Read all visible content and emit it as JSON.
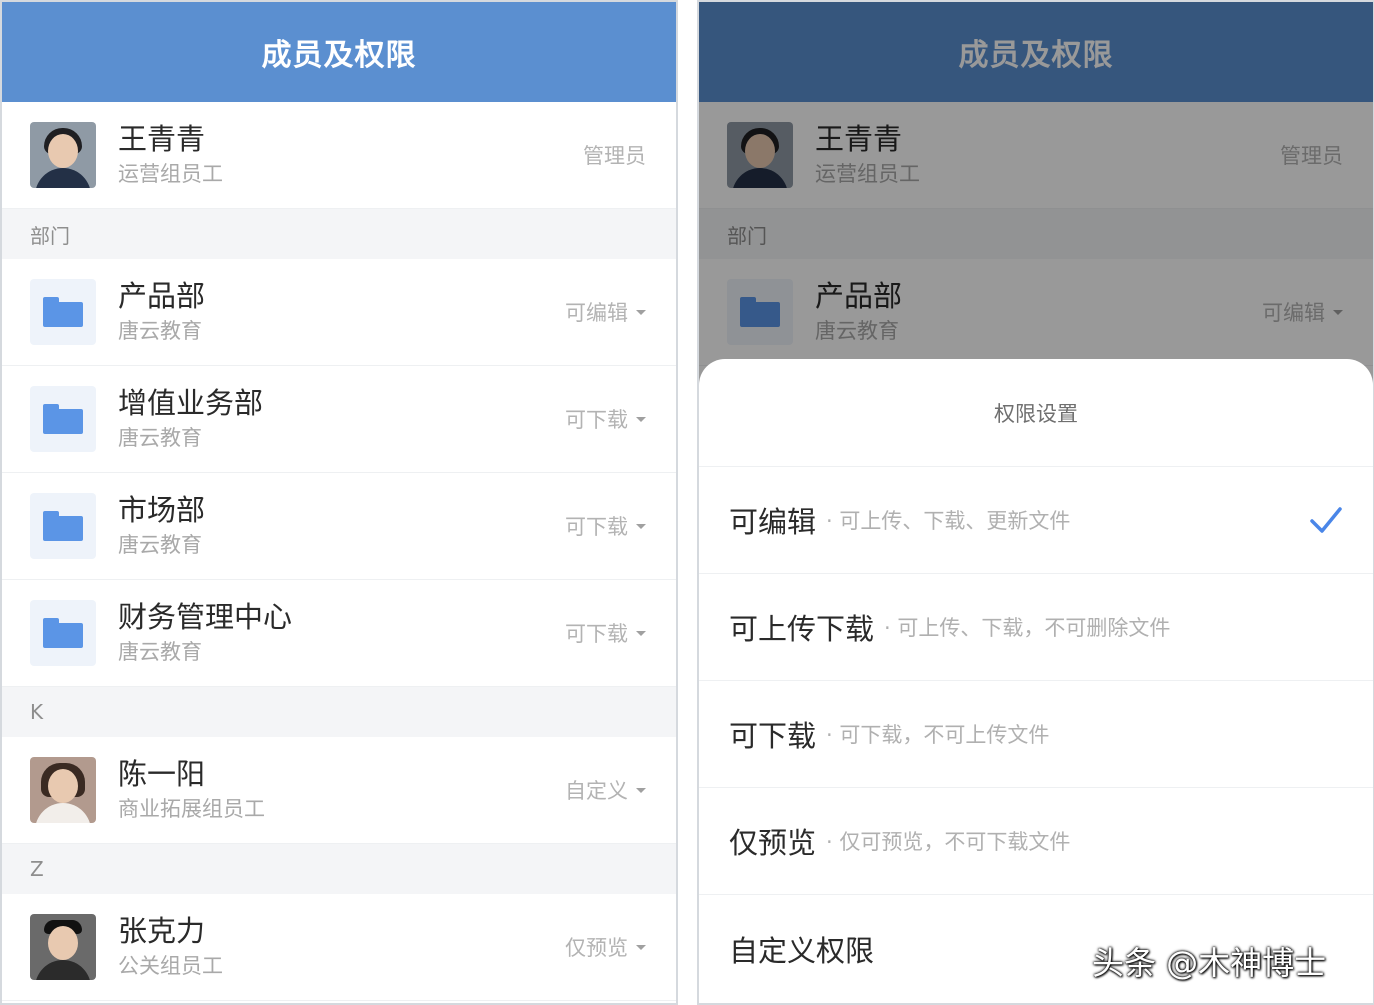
{
  "left": {
    "header": {
      "title": "成员及权限"
    },
    "admin": {
      "name": "王青青",
      "sub": "运营组员工",
      "role": "管理员"
    },
    "sections": {
      "dept": "部门",
      "k": "K",
      "z": "Z"
    },
    "departments": [
      {
        "name": "产品部",
        "sub": "唐云教育",
        "perm": "可编辑"
      },
      {
        "name": "增值业务部",
        "sub": "唐云教育",
        "perm": "可下载"
      },
      {
        "name": "市场部",
        "sub": "唐云教育",
        "perm": "可下载"
      },
      {
        "name": "财务管理中心",
        "sub": "唐云教育",
        "perm": "可下载"
      }
    ],
    "members": [
      {
        "name": "陈一阳",
        "sub": "商业拓展组员工",
        "perm": "自定义"
      },
      {
        "name": "张克力",
        "sub": "公关组员工",
        "perm": "仅预览"
      }
    ]
  },
  "right": {
    "header": {
      "title": "成员及权限"
    },
    "admin": {
      "name": "王青青",
      "sub": "运营组员工",
      "role": "管理员"
    },
    "sections": {
      "dept": "部门"
    },
    "department": {
      "name": "产品部",
      "sub": "唐云教育",
      "perm": "可编辑"
    },
    "sheet": {
      "title": "权限设置",
      "options": [
        {
          "label": "可编辑",
          "desc": "· 可上传、下载、更新文件",
          "selected": true
        },
        {
          "label": "可上传下载",
          "desc": "· 可上传、下载，不可删除文件",
          "selected": false
        },
        {
          "label": "可下载",
          "desc": "· 可下载，不可上传文件",
          "selected": false
        },
        {
          "label": "仅预览",
          "desc": "· 仅可预览，不可下载文件",
          "selected": false
        },
        {
          "label": "自定义权限",
          "desc": "",
          "selected": false
        }
      ]
    }
  },
  "watermark": "头条 @木神博士",
  "colors": {
    "header_left": "#5b8fd0",
    "accent": "#4a86e8",
    "folder": "#5b95e6"
  }
}
